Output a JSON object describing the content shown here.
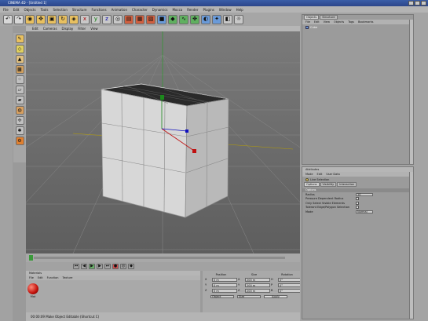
{
  "window": {
    "title": "CINEMA 4D - [Untitled 1]"
  },
  "menu": [
    "File",
    "Edit",
    "Objects",
    "Tools",
    "Selection",
    "Structure",
    "Functions",
    "Animation",
    "Character",
    "Dynamics",
    "Mocca",
    "Render",
    "Plugins",
    "Window",
    "Help"
  ],
  "viewport": {
    "menu": [
      "Edit",
      "Cameras",
      "Display",
      "Filter",
      "View"
    ]
  },
  "object_manager": {
    "tabs": [
      "Objects",
      "Structure"
    ],
    "menu": [
      "File",
      "Edit",
      "View",
      "Objects",
      "Tags",
      "Bookmarks"
    ],
    "objects": [
      {
        "name": "Cube"
      }
    ]
  },
  "attribute_manager": {
    "header": "Attributes",
    "menu": [
      "Mode",
      "Edit",
      "User Data"
    ],
    "tool": "Live Selection",
    "tabs": [
      "Options",
      "Visibility",
      "Interaction"
    ],
    "section": "Options",
    "rows": [
      {
        "label": "Radius",
        "type": "field",
        "value": "10"
      },
      {
        "label": "Pressure Dependent Radius",
        "type": "check"
      },
      {
        "label": "Only Select Visible Elements",
        "type": "check"
      },
      {
        "label": "Tolerant Edge/Polygon Selection",
        "type": "check"
      },
      {
        "label": "Mode",
        "type": "select",
        "value": "Normal"
      }
    ]
  },
  "materials": {
    "title": "Materials",
    "menu": [
      "File",
      "Edit",
      "Function",
      "Texture"
    ],
    "items": [
      {
        "name": "Mat"
      }
    ]
  },
  "coordinates": {
    "columns": [
      "Position",
      "Size",
      "Rotation"
    ],
    "rows": [
      {
        "p_label": "X",
        "p": "0 m",
        "s_label": "X",
        "s": "200 m",
        "r_label": "H",
        "r": "0°"
      },
      {
        "p_label": "Y",
        "p": "0 m",
        "s_label": "Y",
        "s": "200 m",
        "r_label": "P",
        "r": "0°"
      },
      {
        "p_label": "Z",
        "p": "0 m",
        "s_label": "Z",
        "s": "200 m",
        "r_label": "B",
        "r": "0°"
      }
    ],
    "mode": "Object",
    "size_mode": "Size",
    "apply": "Apply"
  },
  "status": {
    "text": "00:00:09  Make Object Editable (Shortcut C)"
  },
  "colors": {
    "title_bar": "#2b468a",
    "viewport": "#6f6f6f",
    "material": "#c0100a"
  }
}
